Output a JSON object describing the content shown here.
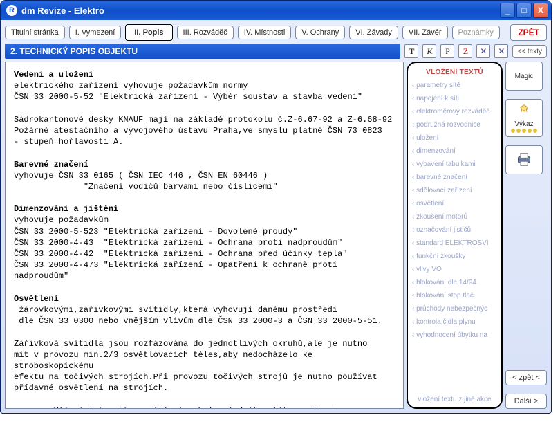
{
  "window": {
    "title": "dm Revize - Elektro",
    "icon_letter": "R"
  },
  "tabs": [
    {
      "label": "Titulní stránka"
    },
    {
      "label": "I. Vymezení"
    },
    {
      "label": "II. Popis",
      "active": true
    },
    {
      "label": "III. Rozváděč"
    },
    {
      "label": "IV. Místnosti"
    },
    {
      "label": "V. Ochrany"
    },
    {
      "label": "VI. Závady"
    },
    {
      "label": "VII. Závěr"
    },
    {
      "label": "Poznámky",
      "notes": true
    }
  ],
  "back_btn": "ZPĚT",
  "section_title": "2. TECHNICKÝ POPIS OBJEKTU",
  "fmt_buttons": [
    "T",
    "K",
    "P",
    "Z"
  ],
  "texts_btn": "<< texty",
  "side": {
    "title": "VLOŽENÍ TEXTŮ",
    "items": [
      "parametry sítě",
      "napojení k síti",
      "elektroměrový rozváděč",
      "podružná rozvodnice",
      "uložení",
      "dimenzování",
      "vybavení tabulkami",
      "barevné značení",
      "sdělovací zařízení",
      "osvětlení",
      "zkoušení motorů",
      "označování jističů",
      "standard ELEKTROSVI",
      "funkční zkoušky",
      "vlivy VO",
      "blokování dle 14/94",
      "blokování stop tlač.",
      "průchody nebezpečnýc",
      "kontrola čidla plynu",
      "vyhodnocení úbytku na"
    ],
    "footer": "vložení textu z jiné akce"
  },
  "tools": {
    "magic": "Magic",
    "wizard": "Výkaz"
  },
  "nav": {
    "prev": "< zpět <",
    "next": "Další >"
  },
  "editor": {
    "body": "Vedení a uložení\nelektrického zařízení vyhovuje požadavkům normy\nČSN 33 2000-5-52 \"Elektrická zařízení - Výběr soustav a stavba vedení\"\n\nSádrokartonové desky KNAUF mají na základě protokolu č.Z-6.67-92 a Z-6.68-92\nPožárně atestačního a vývojového ústavu Praha,ve smyslu platné ČSN 73 0823\n- stupeň hořlavosti A.\n\nBarevné značení\nvyhovuje ČSN 33 0165 ( ČSN IEC 446 , ČSN EN 60446 )\n              \"Značení vodičů barvami nebo číslicemi\"\n\nDimenzování a jištění\nvyhovuje požadavkům\nČSN 33 2000-5-523 \"Elektrická zařízení - Dovolené proudy\"\nČSN 33 2000-4-43  \"Elektrická zařízení - Ochrana proti nadproudům\"\nČSN 33 2000-4-42  \"Elektrická zařízení - Ochrana před účinky tepla\"\nČSN 33 2000-4-473 \"Elektrická zařízení - Opatření k ochraně proti nadproudům\"\n\nOsvětlení\n žárovkovými,zářivkovými svítidly,která vyhovují danému prostředí\n dle ČSN 33 0300 nebo vnějším vlivům dle ČSN 33 2000-3 a ČSN 33 2000-5-51.\n\nZářivková svítidla jsou rozfázována do jednotlivých okruhů,ale je nutno\nmít v provozu min.2/3 osvětlovacích těles,aby nedocházelo ke stroboskopickému\nefektu na točivých strojích.Při provozu točivých strojů je nutno používat\npřídavné osvětlení na strojích.\n\n        Měření intenzity osvětlení nebylo předmětem této revize.|",
    "headings": [
      "Vedení a uložení",
      "Barevné značení",
      "Dimenzování a jištění",
      "Osvětlení"
    ]
  }
}
